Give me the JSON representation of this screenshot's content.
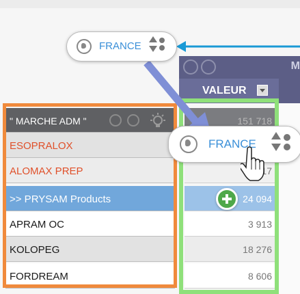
{
  "header": {
    "column_title": "VALEUR",
    "band_letter": "M"
  },
  "rows": [
    {
      "label": "\" MARCHE ADM \"",
      "value": "151 718"
    },
    {
      "label": "ESOPRALOX",
      "value": ""
    },
    {
      "label": "ALOMAX PREP",
      "value": "12 17"
    },
    {
      "label": ">> PRYSAM Products",
      "value": "24 094"
    },
    {
      "label": "APRAM OC",
      "value": "3 913"
    },
    {
      "label": "KOLOPEG",
      "value": "18 276"
    },
    {
      "label": "FORDREAM",
      "value": "8 606"
    }
  ],
  "filter_pill": {
    "label": "FRANCE"
  },
  "drag_pill": {
    "label": "FRANCE"
  },
  "colors": {
    "accent": "#3a8fd8",
    "header": "#6a6d99",
    "highlight_rows": "#e0502a",
    "selected_row": "#71a7db",
    "frame_orange": "#f08a3c",
    "frame_green": "#8fe07a",
    "arrow_blue": "#1a9ad6",
    "arrow_periwinkle": "#7f8fd6",
    "add_green": "#4fa84a"
  },
  "icons": [
    "globe-icon",
    "sort-icon",
    "hand-cursor-icon",
    "plus-icon",
    "lightbulb-icon",
    "ring-icon"
  ]
}
